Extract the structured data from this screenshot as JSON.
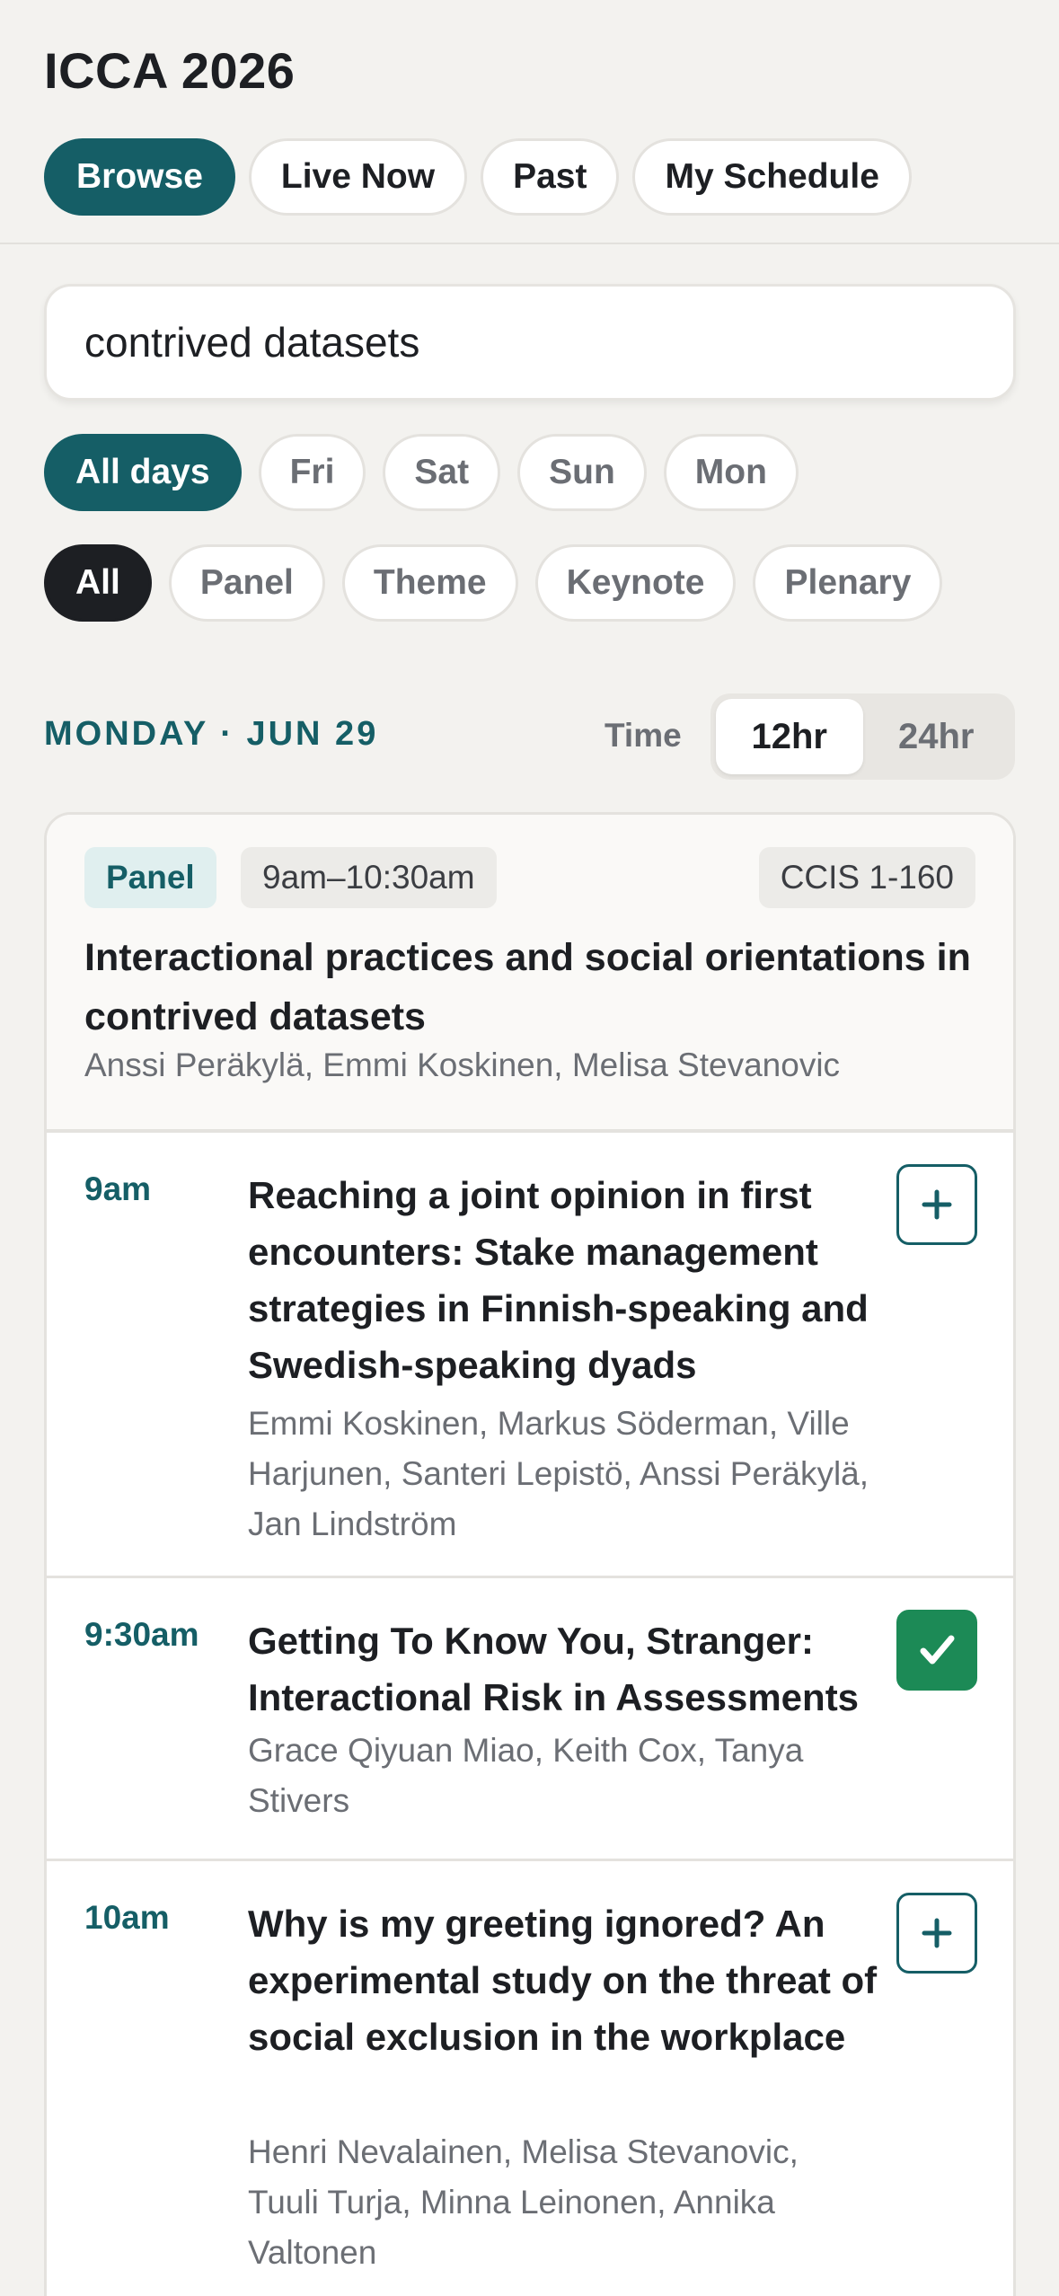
{
  "app": {
    "title": "ICCA 2026"
  },
  "nav": {
    "tabs": [
      "Browse",
      "Live Now",
      "Past",
      "My Schedule"
    ],
    "active": "Browse"
  },
  "search": {
    "value": "contrived datasets",
    "placeholder": ""
  },
  "day_filters": [
    "All days",
    "Fri",
    "Sat",
    "Sun",
    "Mon"
  ],
  "type_filters": [
    "All",
    "Panel",
    "Theme",
    "Keynote",
    "Plenary"
  ],
  "day_heading": "MONDAY · JUN 29",
  "time_toggle": {
    "label": "Time",
    "options": [
      "12hr",
      "24hr"
    ],
    "selected": "12hr"
  },
  "session": {
    "type": "Panel",
    "time": "9am–10:30am",
    "room": "CCIS 1-160",
    "title": "Interactional practices and social orientations in contrived datasets",
    "people": "Anssi Peräkylä, Emmi Koskinen, Melisa Stevanovic",
    "talks": [
      {
        "time": "9am",
        "title": "Reaching a joint opinion in first encounters: Stake management strategies in Finnish-speaking and Swedish-speaking dyads",
        "people": "Emmi Koskinen, Markus Söderman, Ville Harjunen, Santeri Lepistö, Anssi Peräkylä, Jan Lindström",
        "added": false,
        "icon": "plus-icon"
      },
      {
        "time": "9:30am",
        "title": "Getting To Know You, Stranger: Interactional Risk in Assessments",
        "people": "Grace Qiyuan Miao, Keith Cox, Tanya Stivers",
        "added": true,
        "icon": "checkmark-icon"
      },
      {
        "time": "10am",
        "title": "Why is my greeting ignored? An experimental study on the threat of social exclusion in the workplace",
        "people": "Henri Nevalainen, Melisa Stevanovic, Tuuli Turja, Minna Leinonen, Annika Valtonen",
        "added": false,
        "icon": "plus-icon"
      }
    ]
  },
  "colors": {
    "accent": "#155e66",
    "added": "#1c8a56",
    "background": "#f3f2ef"
  }
}
